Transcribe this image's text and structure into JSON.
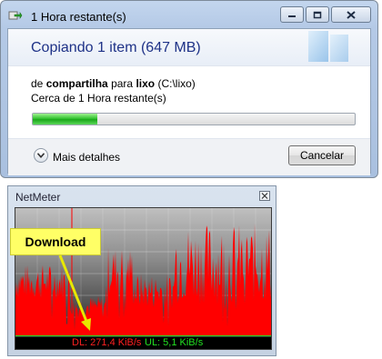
{
  "dialog": {
    "window_title": "1 Hora restante(s)",
    "heading": "Copiando 1 item (647 MB)",
    "from_word": "de",
    "source": "compartilha",
    "to_word": "para",
    "dest_name": "lixo",
    "dest_path": "(C:\\lixo)",
    "time_remaining": "Cerca de 1 Hora restante(s)",
    "progress_percent": 20,
    "details_label": "Mais detalhes",
    "cancel_label": "Cancelar"
  },
  "netmeter": {
    "title": "NetMeter",
    "download_text": "DL: 271,4 KiB/s",
    "upload_text": "UL: 5,1 KiB/s",
    "callout_label": "Download"
  },
  "colors": {
    "heading": "#1e3287",
    "progress": "#35c432",
    "graph_download": "#ff0000",
    "download_text": "#ff2020",
    "upload_text": "#22e022",
    "callout": "#ffff66"
  }
}
